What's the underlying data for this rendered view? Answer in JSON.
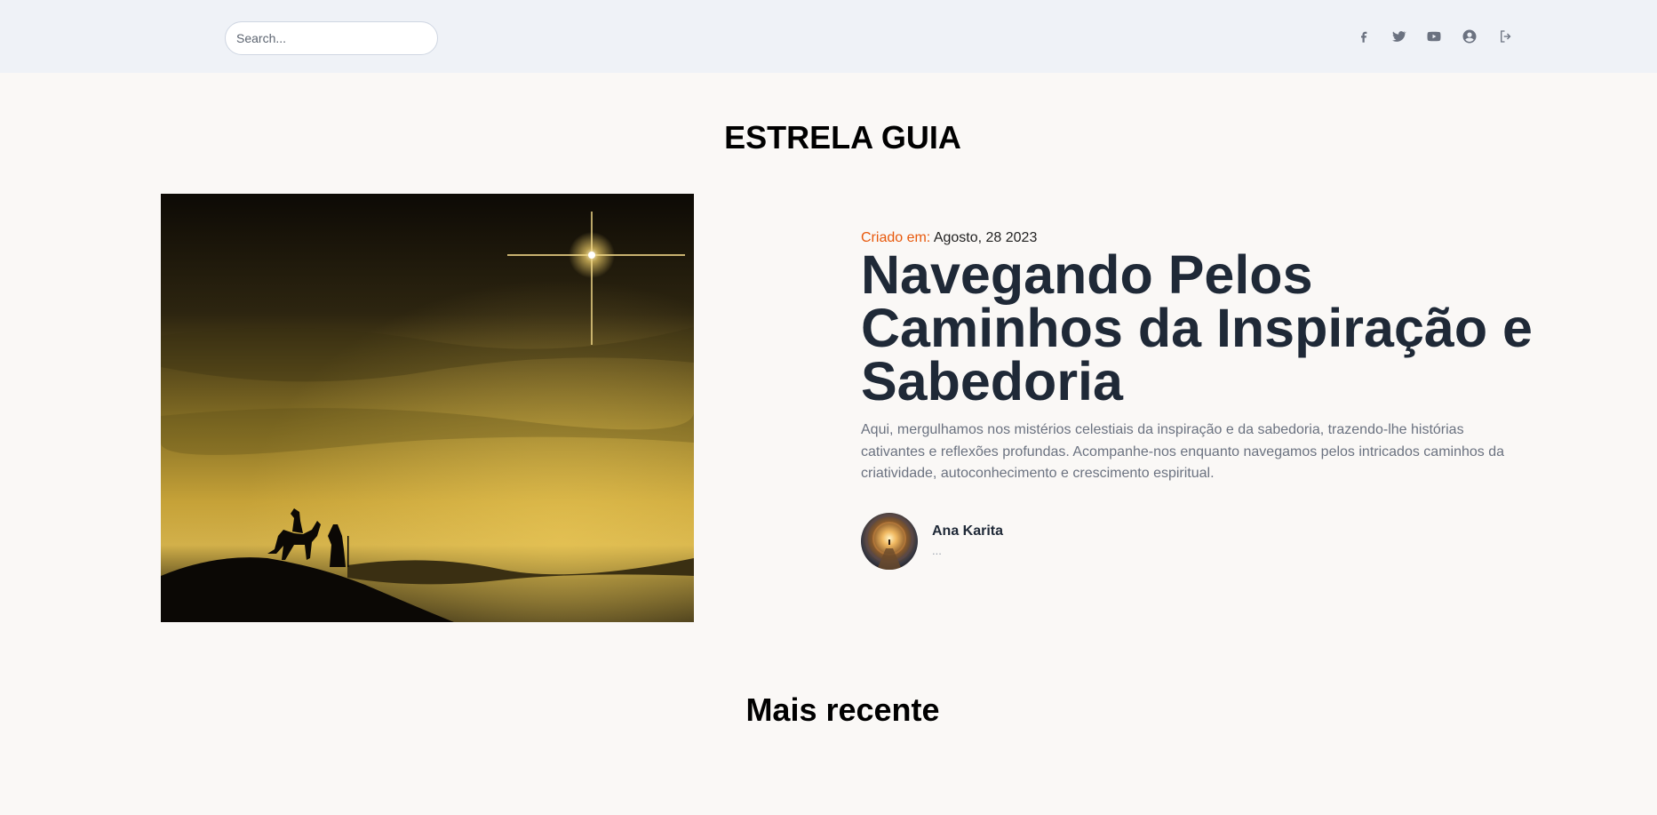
{
  "search": {
    "placeholder": "Search..."
  },
  "social_links": [
    {
      "icon": "facebook-icon"
    },
    {
      "icon": "twitter-icon"
    },
    {
      "icon": "youtube-icon"
    },
    {
      "icon": "user-circle-icon"
    },
    {
      "icon": "logout-icon"
    }
  ],
  "site": {
    "title": "ESTRELA GUIA"
  },
  "featured": {
    "created_label": "Criado em:",
    "date": "Agosto, 28 2023",
    "title": "Navegando Pelos Caminhos da Inspiração e Sabedoria",
    "excerpt": "Aqui, mergulhamos nos mistérios celestiais da inspiração e da sabedoria, trazendo-lhe histórias cativantes e reflexões profundas. Acompanhe-nos enquanto navegamos pelos intricados caminhos da criatividade, autoconhecimento e crescimento espiritual.",
    "author": {
      "name": "Ana Karita",
      "bio": "..."
    }
  },
  "recent": {
    "heading": "Mais recente"
  },
  "colors": {
    "topbar_bg": "#eff2f7",
    "page_bg": "#faf8f6",
    "accent": "#e8590c",
    "title_text": "#1f2937",
    "muted_text": "#6b7280"
  }
}
